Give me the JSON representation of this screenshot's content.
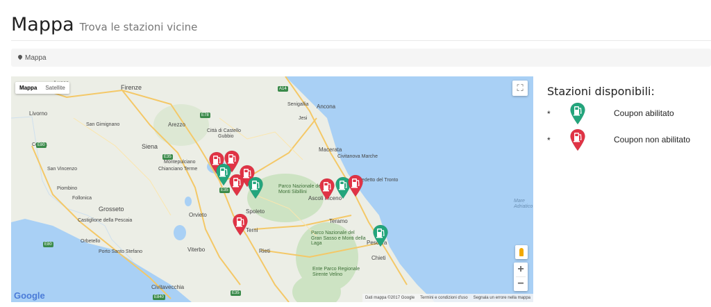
{
  "header": {
    "title": "Mappa",
    "subtitle": "Trova le stazioni vicine"
  },
  "breadcrumb": {
    "icon": "map-marker-icon",
    "label": "Mappa"
  },
  "map": {
    "type_controls": [
      "Mappa",
      "Satellite"
    ],
    "fullscreen_icon": "fullscreen-icon",
    "zoom_in": "+",
    "zoom_out": "−",
    "logo": "Google",
    "attribution": [
      "Dati mappa ©2017 Google",
      "Termini e condizioni d'uso",
      "Segnala un errore nella mappa"
    ],
    "labels": [
      {
        "text": "Lucca",
        "size": 8
      },
      {
        "text": "Firenze",
        "size": 9
      },
      {
        "text": "Livorno",
        "size": 8
      },
      {
        "text": "San Gimignano",
        "size": 7
      },
      {
        "text": "Arezzo",
        "size": 8
      },
      {
        "text": "Cecina",
        "size": 7
      },
      {
        "text": "Siena",
        "size": 9
      },
      {
        "text": "Montepulciano",
        "size": 7
      },
      {
        "text": "San Vincenzo",
        "size": 7
      },
      {
        "text": "Piombino",
        "size": 7
      },
      {
        "text": "Follonica",
        "size": 7
      },
      {
        "text": "Grosseto",
        "size": 9
      },
      {
        "text": "Castiglione della Pescaia",
        "size": 7
      },
      {
        "text": "Orbetello",
        "size": 7
      },
      {
        "text": "Porto Santo Stefano",
        "size": 7
      },
      {
        "text": "Orvieto",
        "size": 8
      },
      {
        "text": "Viterbo",
        "size": 8
      },
      {
        "text": "Civitavecchia",
        "size": 8
      },
      {
        "text": "Chianciano Terme",
        "size": 7
      },
      {
        "text": "Città di Castello",
        "size": 7
      },
      {
        "text": "Gubbio",
        "size": 7
      },
      {
        "text": "Senigallia",
        "size": 7
      },
      {
        "text": "Ancona",
        "size": 8
      },
      {
        "text": "Jesi",
        "size": 7
      },
      {
        "text": "Macerata",
        "size": 8
      },
      {
        "text": "Civitanova Marche",
        "size": 7
      },
      {
        "text": "Parco Nazionale dei Monti Sibillini",
        "size": 7
      },
      {
        "text": "Spoleto",
        "size": 8
      },
      {
        "text": "Terni",
        "size": 8
      },
      {
        "text": "Rieti",
        "size": 8
      },
      {
        "text": "Ascoli Piceno",
        "size": 8
      },
      {
        "text": "San Benedetto del Tronto",
        "size": 7
      },
      {
        "text": "Teramo",
        "size": 8
      },
      {
        "text": "Parco Nazionale del Gran Sasso e Monti della Laga",
        "size": 7
      },
      {
        "text": "Pescara",
        "size": 8
      },
      {
        "text": "Chieti",
        "size": 8
      },
      {
        "text": "Ente Parco Regionale Sirente Velino",
        "size": 7
      },
      {
        "text": "Mare Adriatico",
        "size": 7
      }
    ],
    "road_shields": [
      "A14",
      "E78",
      "E35",
      "E80",
      "E35",
      "E80",
      "E840",
      "E35"
    ],
    "markers": [
      {
        "status": "non_abilitato",
        "color": "#e03345"
      },
      {
        "status": "non_abilitato",
        "color": "#e03345"
      },
      {
        "status": "abilitato",
        "color": "#23a57c"
      },
      {
        "status": "non_abilitato",
        "color": "#e03345"
      },
      {
        "status": "non_abilitato",
        "color": "#e03345"
      },
      {
        "status": "abilitato",
        "color": "#23a57c"
      },
      {
        "status": "non_abilitato",
        "color": "#e03345"
      },
      {
        "status": "non_abilitato",
        "color": "#e03345"
      },
      {
        "status": "abilitato",
        "color": "#23a57c"
      },
      {
        "status": "non_abilitato",
        "color": "#e03345"
      },
      {
        "status": "abilitato",
        "color": "#23a57c"
      }
    ]
  },
  "legend": {
    "title": "Stazioni disponibili:",
    "items": [
      {
        "bullet": "*",
        "icon": "fuel-pump-marker-icon",
        "color": "#23a57c",
        "label": "Coupon abilitato"
      },
      {
        "bullet": "*",
        "icon": "fuel-pump-marker-icon",
        "color": "#e03345",
        "label": "Coupon non abilitato"
      }
    ]
  }
}
